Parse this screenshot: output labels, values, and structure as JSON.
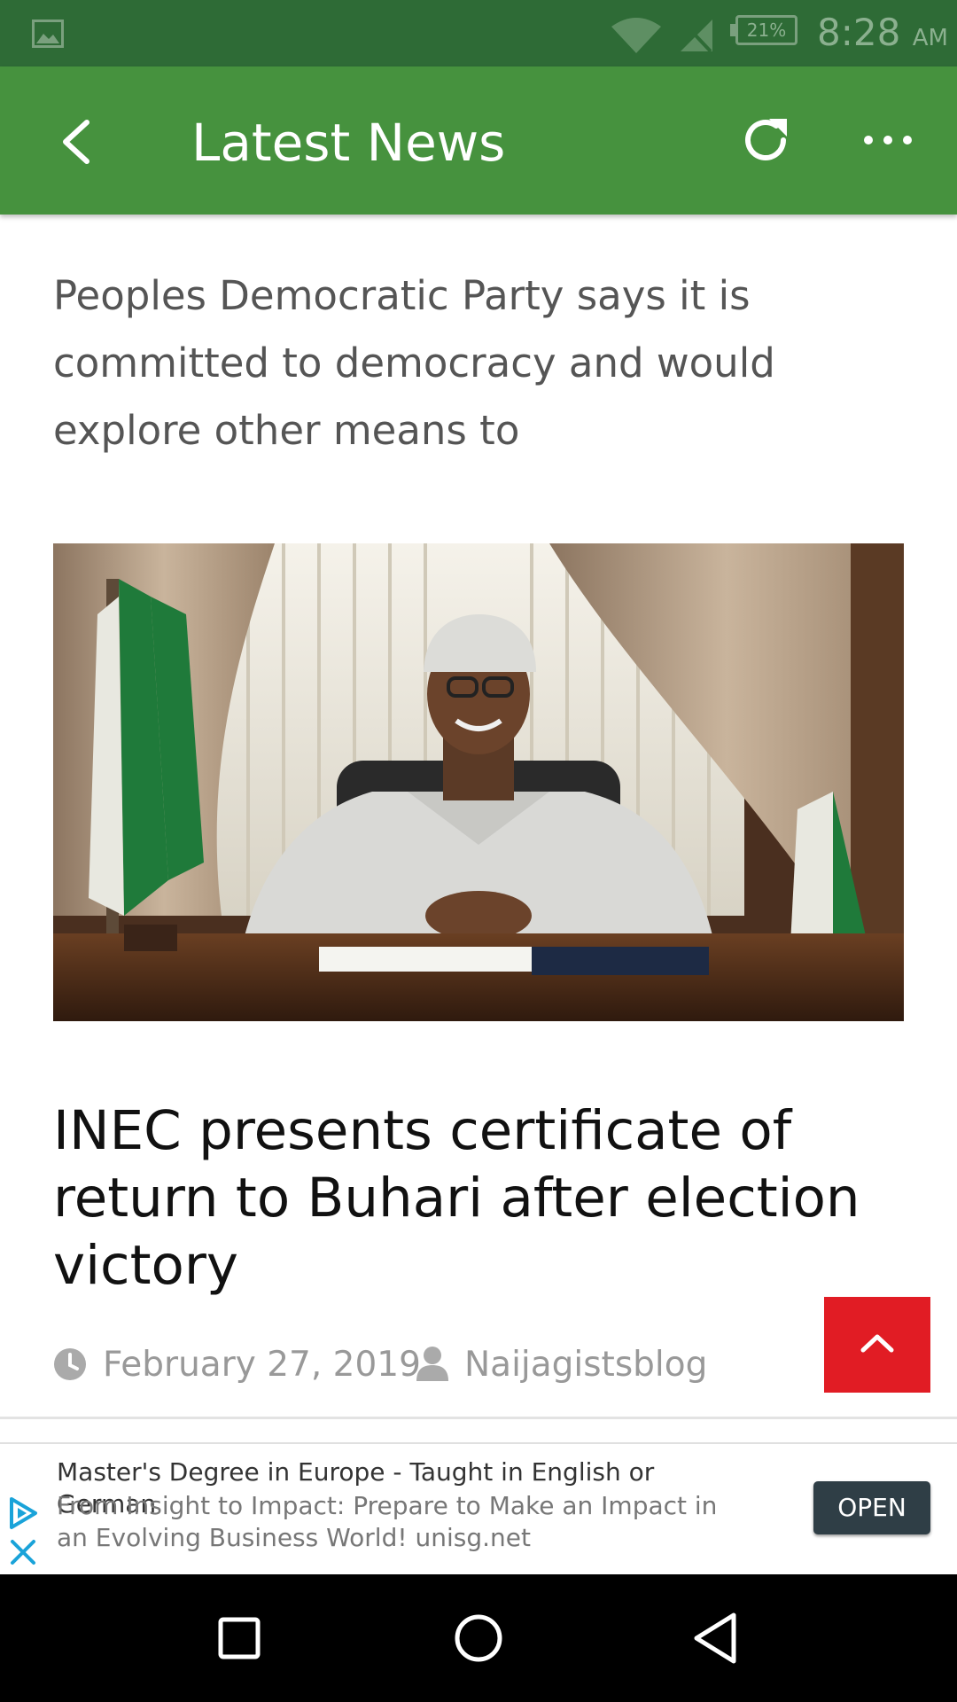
{
  "status_bar": {
    "battery_percent": "21%",
    "time": "8:28",
    "time_suffix": "AM",
    "icons": [
      "gallery-icon",
      "wifi-icon",
      "no-sim-icon",
      "battery-icon"
    ]
  },
  "app_bar": {
    "title": "Latest News",
    "icons": [
      "back-arrow-icon",
      "refresh-icon",
      "more-options-icon"
    ]
  },
  "article": {
    "excerpt": "Peoples Democratic Party says it is committed to democracy and would explore other means to",
    "title": "INEC presents certificate of return to Buhari after election victory",
    "date": "February 27, 2019",
    "author": "Naijagistsblog"
  },
  "ad": {
    "title": "Master's Degree in Europe - Taught in English or German",
    "description": "From Insight to Impact: Prepare to Make an Impact in an Evolving Business World! unisg.net",
    "button_label": "OPEN"
  },
  "colors": {
    "status_bar": "#2e6b36",
    "app_bar": "#46923e",
    "scroll_top_button": "#e11c24",
    "ad_button": "#2f3e46",
    "nav_bar": "#000000"
  }
}
